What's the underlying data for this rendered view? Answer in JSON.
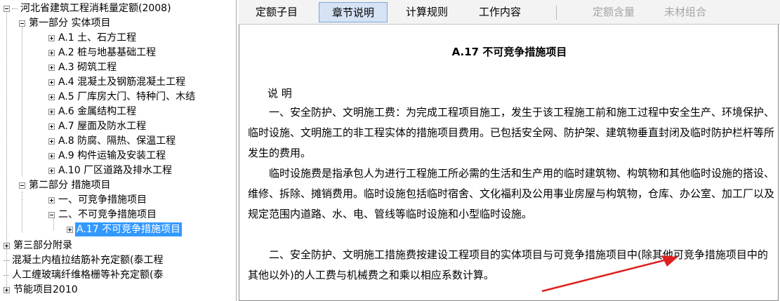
{
  "tree": {
    "root": "河北省建筑工程消耗量定额(2008)",
    "part1": "第一部分 实体项目",
    "part1_items": [
      "A.1 土、石方工程",
      "A.2 桩与地基基础工程",
      "A.3 砌筑工程",
      "A.4 混凝土及钢筋混凝土工程",
      "A.5 厂库房大门、特种门、木结",
      "A.6 金属结构工程",
      "A.7 屋面及防水工程",
      "A.8 防腐、隔热、保温工程",
      "A.9 构件运输及安装工程",
      "A.10 厂区道路及排水工程"
    ],
    "part2": "第二部分 措施项目",
    "part2_items": [
      "一、可竞争措施项目",
      "二、不可竞争措施项目"
    ],
    "selected": "A.17 不可竞争措施项目",
    "part3": "第三部分附录",
    "extra1": "混凝土内植拉结筋补充定额(泰工程",
    "extra2": "人工缠玻璃纤维格栅等补充定额(泰",
    "extra3": "节能项目2010"
  },
  "tabs": [
    {
      "label": "定额子目",
      "state": "normal"
    },
    {
      "label": "章节说明",
      "state": "active"
    },
    {
      "label": "计算规则",
      "state": "normal"
    },
    {
      "label": "工作内容",
      "state": "normal"
    },
    {
      "label": "定额含量",
      "state": "disabled"
    },
    {
      "label": "未材组合",
      "state": "disabled"
    }
  ],
  "document": {
    "title": "A.17 不可竞争措施项目",
    "heading": "说 明",
    "paragraphs": [
      "一、安全防护、文明施工费：为完成工程项目施工，发生于该工程施工前和施工过程中安全生产、环境保护、临时设施、文明施工的非工程实体的措施项目费用。已包括安全网、防护架、建筑物垂直封闭及临时防护栏杆等所发生的费用。",
      "临时设施费是指承包人为进行工程施工所必需的生活和生产用的临时建筑物、构筑物和其他临时设施的搭设、维修、拆除、摊销费用。临时设施包括临时宿舍、文化福利及公用事业房屋与构筑物，仓库、办公室、加工厂以及规定范围内道路、水、电、管线等临时设施和小型临时设施。",
      "二、安全防护、文明施工措施费按建设工程项目的实体项目与可竞争措施项目中(除其他可竞争措施项目中的其他以外)的人工费与机械费之和乘以相应系数计算。"
    ]
  },
  "colors": {
    "selection": "#3399ff",
    "tab_active": "#d5e3f5",
    "arrow": "#e02020"
  }
}
